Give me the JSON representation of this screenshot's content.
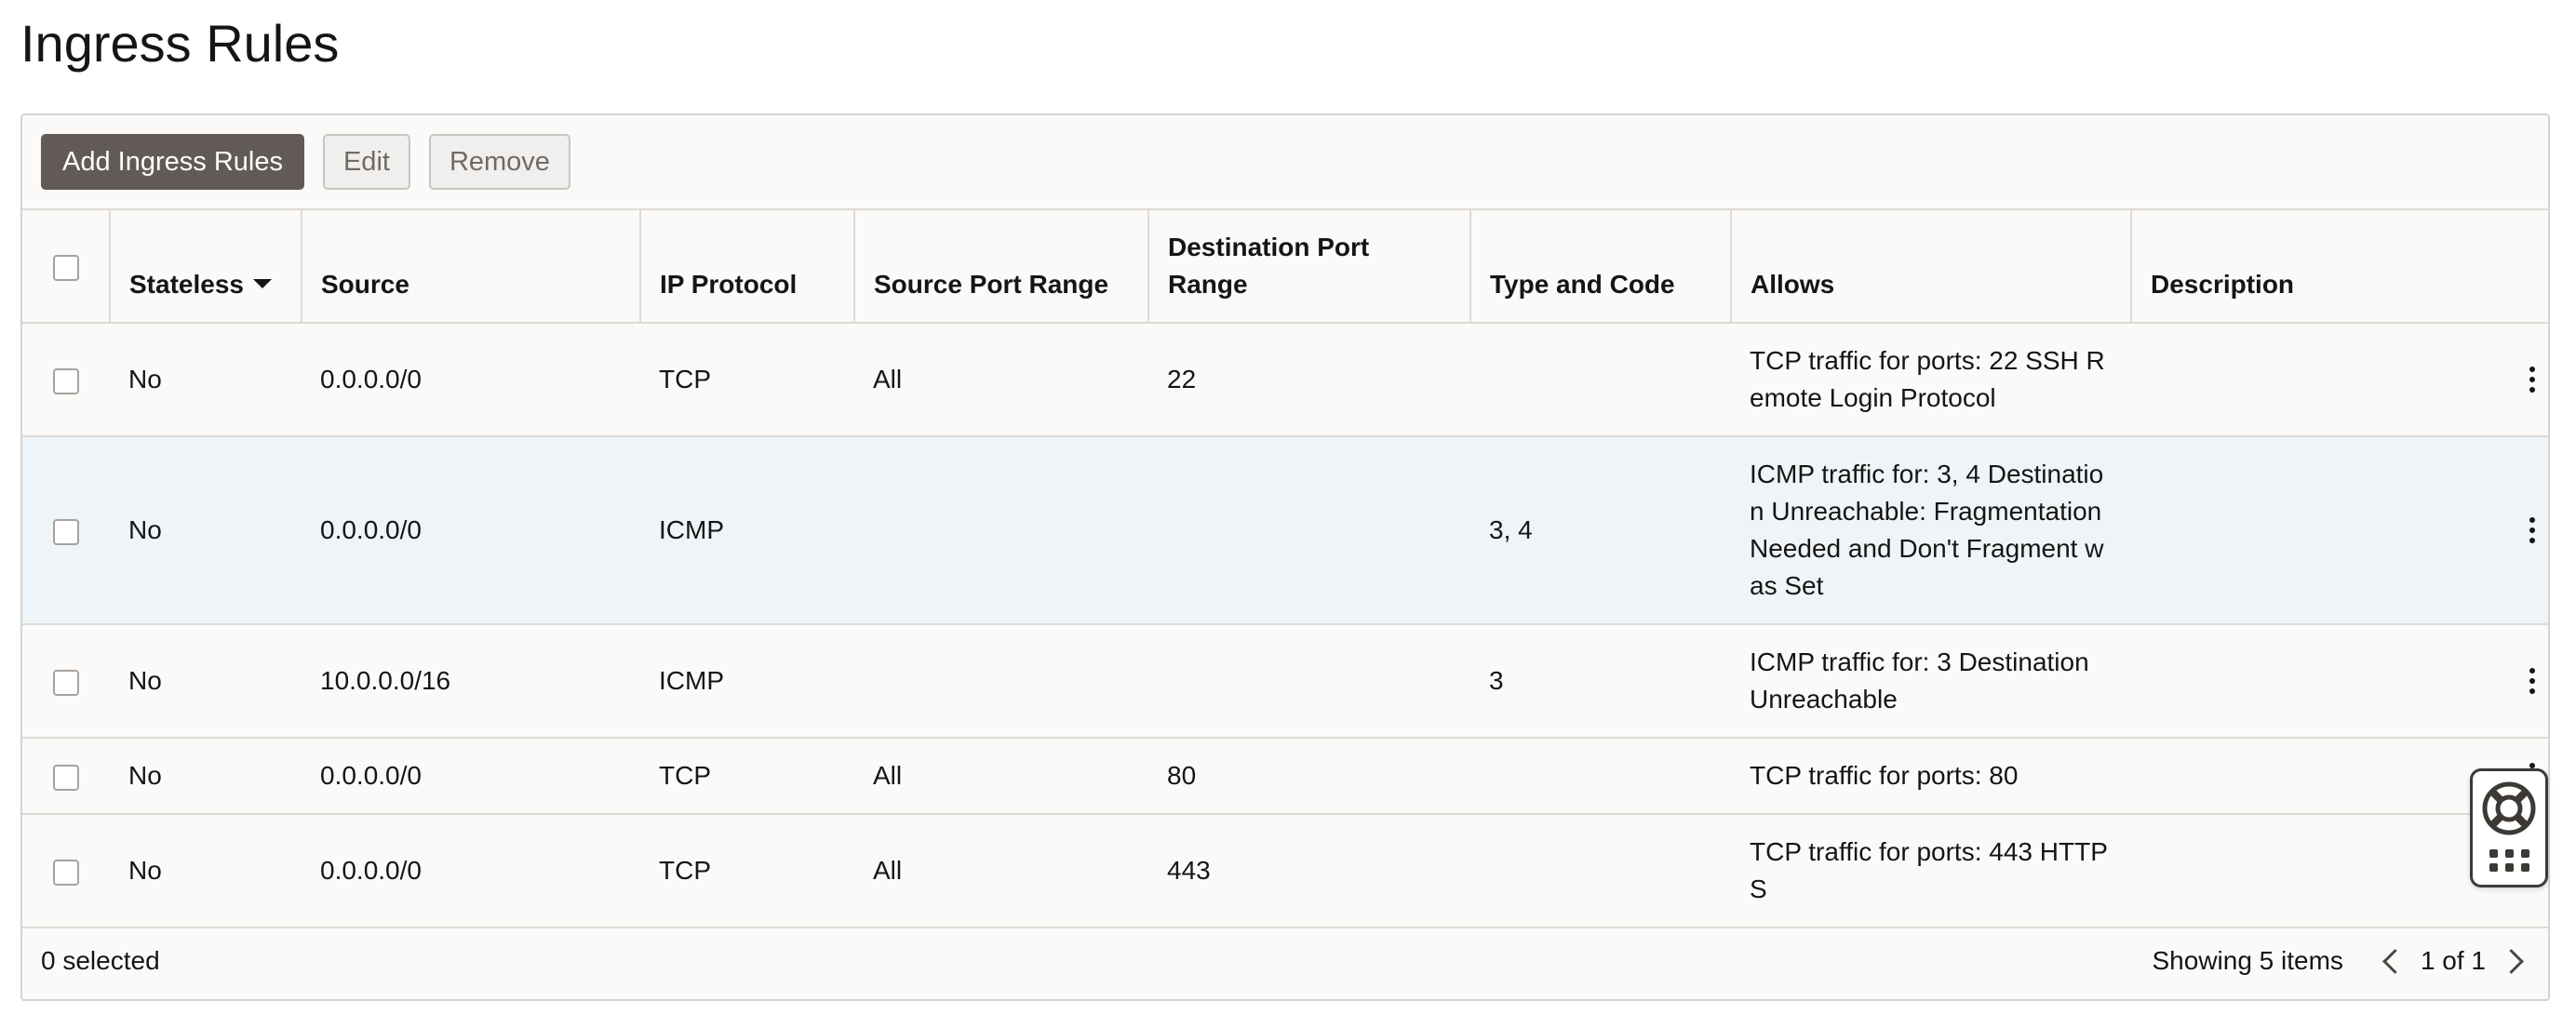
{
  "page": {
    "title": "Ingress Rules"
  },
  "toolbar": {
    "add_label": "Add Ingress Rules",
    "edit_label": "Edit",
    "remove_label": "Remove"
  },
  "table": {
    "headers": {
      "stateless": "Stateless",
      "source": "Source",
      "ip_protocol": "IP Protocol",
      "source_port_range": "Source Port Range",
      "destination_port_range": "Destination Port Range",
      "type_and_code": "Type and Code",
      "allows": "Allows",
      "description": "Description"
    },
    "sort": {
      "column": "Stateless",
      "direction": "descending"
    },
    "rows": [
      {
        "stateless": "No",
        "source": "0.0.0.0/0",
        "ip_protocol": "TCP",
        "source_port_range": "All",
        "destination_port_range": "22",
        "type_and_code": "",
        "allows": "TCP traffic for ports: 22 SSH Remote Login Protocol",
        "description": ""
      },
      {
        "stateless": "No",
        "source": "0.0.0.0/0",
        "ip_protocol": "ICMP",
        "source_port_range": "",
        "destination_port_range": "",
        "type_and_code": "3, 4",
        "allows": "ICMP traffic for: 3, 4 Destination Unreachable: Fragmentation Needed and Don't Fragment was Set",
        "description": ""
      },
      {
        "stateless": "No",
        "source": "10.0.0.0/16",
        "ip_protocol": "ICMP",
        "source_port_range": "",
        "destination_port_range": "",
        "type_and_code": "3",
        "allows": "ICMP traffic for: 3 Destination Unreachable",
        "description": ""
      },
      {
        "stateless": "No",
        "source": "0.0.0.0/0",
        "ip_protocol": "TCP",
        "source_port_range": "All",
        "destination_port_range": "80",
        "type_and_code": "",
        "allows": "TCP traffic for ports: 80",
        "description": ""
      },
      {
        "stateless": "No",
        "source": "0.0.0.0/0",
        "ip_protocol": "TCP",
        "source_port_range": "All",
        "destination_port_range": "443",
        "type_and_code": "",
        "allows": "TCP traffic for ports: 443 HTTPS",
        "description": ""
      }
    ]
  },
  "footer": {
    "selected": "0 selected",
    "showing": "Showing 5 items",
    "page": "1 of 1"
  },
  "icons": {
    "sort": "sort-descending-icon",
    "row_actions": "kebab-menu-icon",
    "help": "lifebuoy-icon",
    "apps": "grid-dots-icon",
    "prev": "chevron-left-icon",
    "next": "chevron-right-icon"
  },
  "colors": {
    "primary_button": "#625a56",
    "highlight_row": "#eef4f8",
    "panel_bg": "#fbfaf8"
  }
}
